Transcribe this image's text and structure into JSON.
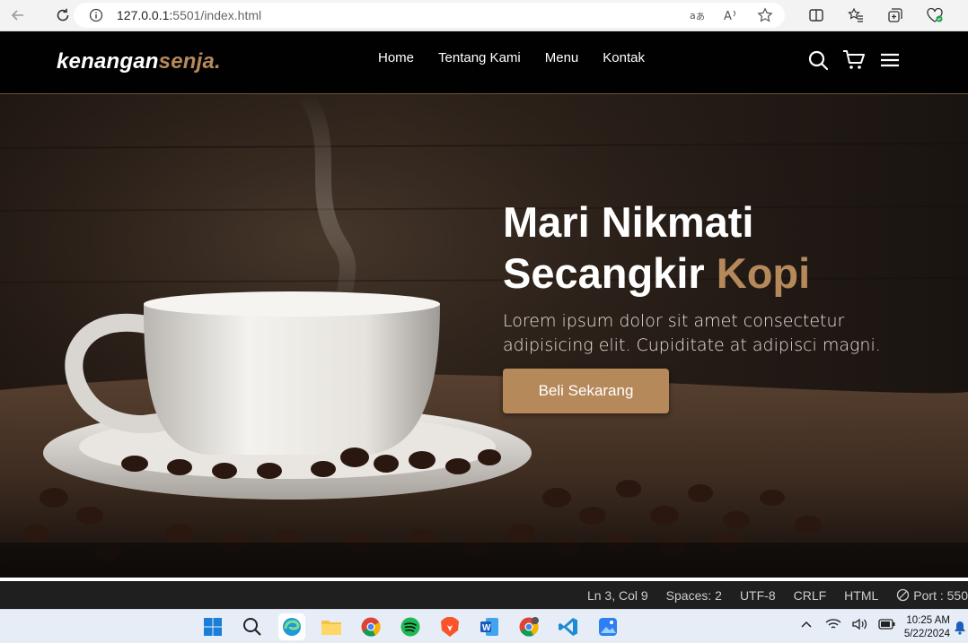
{
  "browser": {
    "url_host": "127.0.0.1:",
    "url_rest": "5501/index.html"
  },
  "site": {
    "logo_main": "kenangan",
    "logo_accent": "senja.",
    "nav": [
      "Home",
      "Tentang Kami",
      "Menu",
      "Kontak"
    ]
  },
  "hero": {
    "title_line1": "Mari Nikmati",
    "title_line2_main": "Secangkir",
    "title_line2_accent": "Kopi",
    "subtitle": "Lorem ipsum dolor sit amet consectetur adipisicing elit. Cupiditate at adipisci magni.",
    "cta": "Beli Sekarang"
  },
  "statusbar": {
    "position": "Ln 3, Col 9",
    "spaces": "Spaces: 2",
    "encoding": "UTF-8",
    "eol": "CRLF",
    "language": "HTML",
    "port": "Port : 550"
  },
  "taskbar": {
    "time": "10:25 AM",
    "date": "5/22/2024"
  },
  "colors": {
    "accent": "#b6895b",
    "header_bg": "#010101",
    "statusbar_bg": "#1f1f1f"
  }
}
